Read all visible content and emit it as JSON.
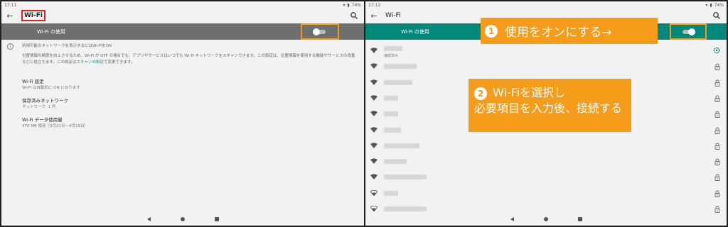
{
  "left": {
    "status": {
      "time": "17:11",
      "battery": "74%"
    },
    "title": "Wi-Fi",
    "toggle": {
      "label": "Wi-Fi の使用",
      "state": "off"
    },
    "info": {
      "line1": "利用可能なネットワークを表示するにはWi-FiをON",
      "line2a": "位置情報の精度を向上させるため、Wi-Fi が OFF の場合でも、アプリやサービスはいつでも Wi-Fi ネットワークをスキャンできます。この設定は、位置情報を使用する機能やサービスの改善",
      "line2b": "などに役立ちます。この設定は",
      "link": "スキャンの設定",
      "line2c": "で変更できます。"
    },
    "prefs": [
      {
        "title": "Wi-Fi 設定",
        "sub": "Wi-Fi は自動的に ON になります"
      },
      {
        "title": "保存済みネットワーク",
        "sub": "ネットワーク: 1 件"
      },
      {
        "title": "Wi-Fi データ使用量",
        "sub": "470 MB 使用（3月21日～4月18日）"
      }
    ]
  },
  "right": {
    "status": {
      "time": "17:12",
      "battery": "74%"
    },
    "title": "Wi-Fi",
    "toggle": {
      "label": "Wi-Fi の使用",
      "state": "on"
    },
    "connected_label": "接続済み",
    "callout1": {
      "num": "1",
      "text": "使用をオンにする→"
    },
    "callout2": {
      "num": "2",
      "line1": "Wi-Fiを選択し",
      "line2": "必要項目を入力後、接続する"
    },
    "networks": [
      {
        "type": "gear",
        "signal": 4
      },
      {
        "type": "lock",
        "signal": 4
      },
      {
        "type": "lock",
        "signal": 4
      },
      {
        "type": "lock",
        "signal": 4
      },
      {
        "type": "lock",
        "signal": 4
      },
      {
        "type": "lock",
        "signal": 4
      },
      {
        "type": "lock",
        "signal": 4
      },
      {
        "type": "lock",
        "signal": 4
      },
      {
        "type": "lock",
        "signal": 4
      },
      {
        "type": "lock",
        "signal": 3
      },
      {
        "type": "lock",
        "signal": 3
      }
    ]
  },
  "colors": {
    "accent": "#00897b",
    "callout": "#f59c1a",
    "highlight_box": "#e02020",
    "toggle_bar_off": "#6f6f6f"
  }
}
